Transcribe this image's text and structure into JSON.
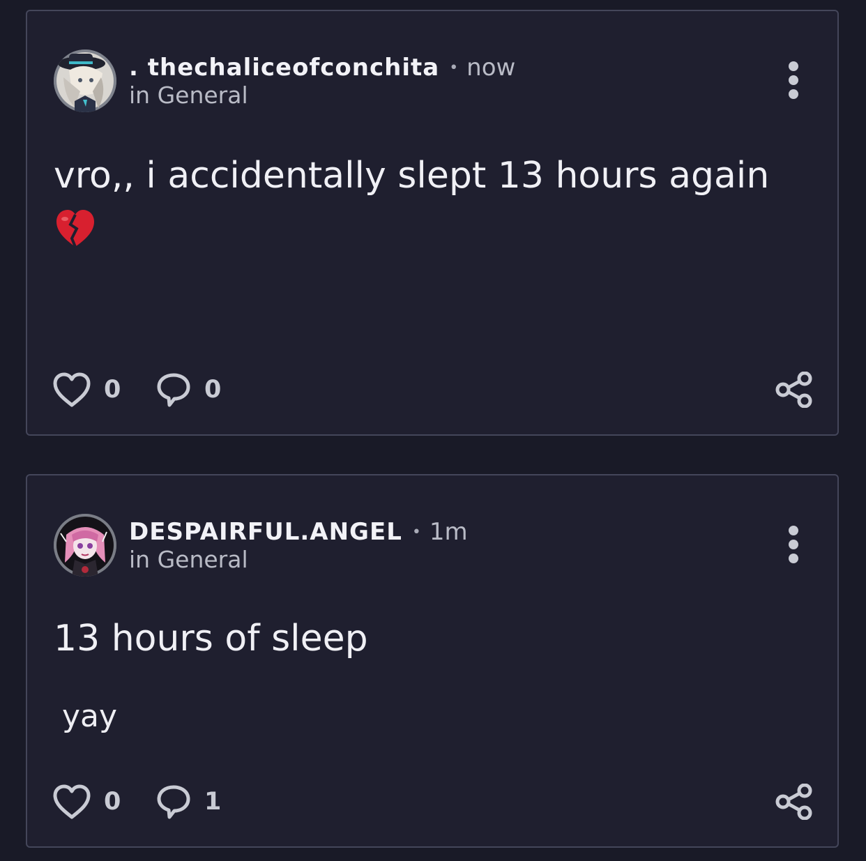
{
  "posts": [
    {
      "author": ". thechaliceofconchita",
      "time": "now",
      "channel": "in General",
      "body": "vro,, i accidentally slept 13 hours again",
      "emoji": "broken-heart-emoji",
      "extra": "",
      "likes": "0",
      "comments": "0"
    },
    {
      "author": "DESPAIRFUL.ANGEL",
      "time": "1m",
      "channel": "in General",
      "body": "13 hours of sleep",
      "extra": "yay",
      "likes": "0",
      "comments": "1"
    }
  ],
  "separator": "•",
  "icons": {
    "like": "heart-outline-icon",
    "comment": "speech-bubble-icon",
    "share": "share-icon",
    "menu": "kebab-menu-icon"
  },
  "colors": {
    "background": "#191a27",
    "card": "#1f1f2f",
    "card_border": "#44465a",
    "text": "#f0f0f5",
    "muted_text": "#b9bbc6",
    "icon": "#c9cbd4",
    "emoji_red": "#d8202f"
  }
}
